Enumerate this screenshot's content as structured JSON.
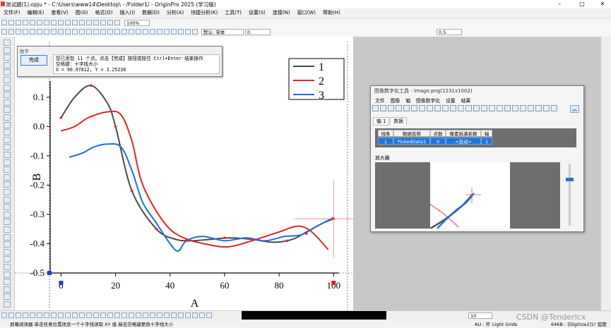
{
  "app": {
    "title": "测试题(1).opju * - C:\\Users\\www14\\Desktop\\ - /Folder1/ - OriginPro 2025 (学习版)"
  },
  "menu": [
    "文件(F)",
    "编辑(E)",
    "查看(V)",
    "图(G)",
    "格式(O)",
    "插入(I)",
    "数据(D)",
    "分析(A)",
    "快捷分析(K)",
    "工具(T)",
    "设置(S)",
    "连接(N)",
    "窗口(W)",
    "帮助(H)"
  ],
  "toolbar": {
    "zoom": "100%",
    "font": "默认: 宋体",
    "font_size": "0",
    "line_width": "0.5"
  },
  "tooltip": {
    "title": "数字",
    "done_label": "完成",
    "line1": "您已添加 11 个点。点击【完成】按钮或按住 Ctrl+Enter 结束操作",
    "line2": "空格键：十字线大小",
    "line3": "X = 90.97812, Y = 3.25238"
  },
  "graph": {
    "xlabel": "A",
    "ylabel": "B",
    "x_ticks": [
      "0",
      "20",
      "40",
      "60",
      "80",
      "100"
    ],
    "y_ticks": [
      "0.1",
      "0.0",
      "-0.1",
      "-0.2",
      "-0.3",
      "-0.4",
      "-0.5"
    ],
    "legend": [
      "1",
      "2",
      "3"
    ],
    "colors": {
      "series1": "#4a4a4a",
      "series2": "#e02424",
      "series3": "#1f6fd6"
    }
  },
  "chart_data": {
    "type": "line",
    "xlim": [
      -4,
      102
    ],
    "ylim": [
      -0.5,
      0.155
    ],
    "xlabel": "A",
    "ylabel": "B",
    "legend_position": "top-right",
    "series": [
      {
        "name": "1",
        "color": "#4a4a4a",
        "x": [
          0,
          5,
          11,
          17,
          20,
          26,
          35,
          42,
          48,
          55,
          62,
          70,
          78,
          85,
          90,
          96,
          100
        ],
        "y": [
          0.03,
          0.1,
          0.14,
          0.08,
          0.0,
          -0.22,
          -0.35,
          -0.385,
          -0.39,
          -0.385,
          -0.38,
          -0.385,
          -0.395,
          -0.385,
          -0.36,
          -0.33,
          -0.315
        ]
      },
      {
        "name": "2",
        "color": "#e02424",
        "x": [
          0,
          5,
          10,
          17,
          22,
          26,
          30,
          38,
          45,
          55,
          62,
          70,
          80,
          87,
          92,
          98
        ],
        "y": [
          -0.015,
          0.0,
          0.03,
          0.05,
          0.04,
          -0.05,
          -0.2,
          -0.33,
          -0.38,
          -0.405,
          -0.41,
          -0.39,
          -0.36,
          -0.34,
          -0.36,
          -0.42
        ]
      },
      {
        "name": "3",
        "color": "#1f6fd6",
        "x": [
          3,
          8,
          12,
          17,
          22,
          26,
          30,
          35,
          40,
          43,
          46,
          52,
          60,
          68,
          75,
          82,
          88,
          94,
          100
        ],
        "y": [
          -0.105,
          -0.09,
          -0.07,
          -0.06,
          -0.07,
          -0.15,
          -0.26,
          -0.33,
          -0.4,
          -0.425,
          -0.39,
          -0.375,
          -0.39,
          -0.38,
          -0.39,
          -0.375,
          -0.37,
          -0.34,
          -0.31
        ]
      }
    ],
    "digitized_points": {
      "x": [
        0,
        11,
        20,
        26,
        35,
        46,
        60,
        70,
        83,
        90,
        100
      ],
      "y": [
        0.03,
        0.14,
        0.0,
        -0.22,
        -0.35,
        -0.39,
        -0.38,
        -0.385,
        -0.39,
        -0.365,
        -0.315
      ]
    }
  },
  "digitizer": {
    "title": "图像数字化工具 - image.png(1231x1002)",
    "menu": [
      "文件",
      "图像",
      "轴",
      "图像数字化",
      "设置",
      "结果"
    ],
    "tabs": [
      "轴 1",
      "数据"
    ],
    "columns": [
      "线条",
      "数据名称",
      "点数",
      "像素拆满系数",
      "轴"
    ],
    "row": [
      "1",
      "PickedData1",
      "0",
      "<自动>",
      "1"
    ],
    "magnifier_label": "放大器"
  },
  "bottom": {
    "zoom": "10"
  },
  "status": {
    "left": "屏幕阅读器 单击任意位置改变一个十字线读取 XY 值  敲击空格键更改十字线大小",
    "au": "AU : 开",
    "grids": "Light Grids",
    "right": "64KB : [Digitize2]1!   弧度"
  },
  "watermark": "CSDN @Tenderlcx"
}
